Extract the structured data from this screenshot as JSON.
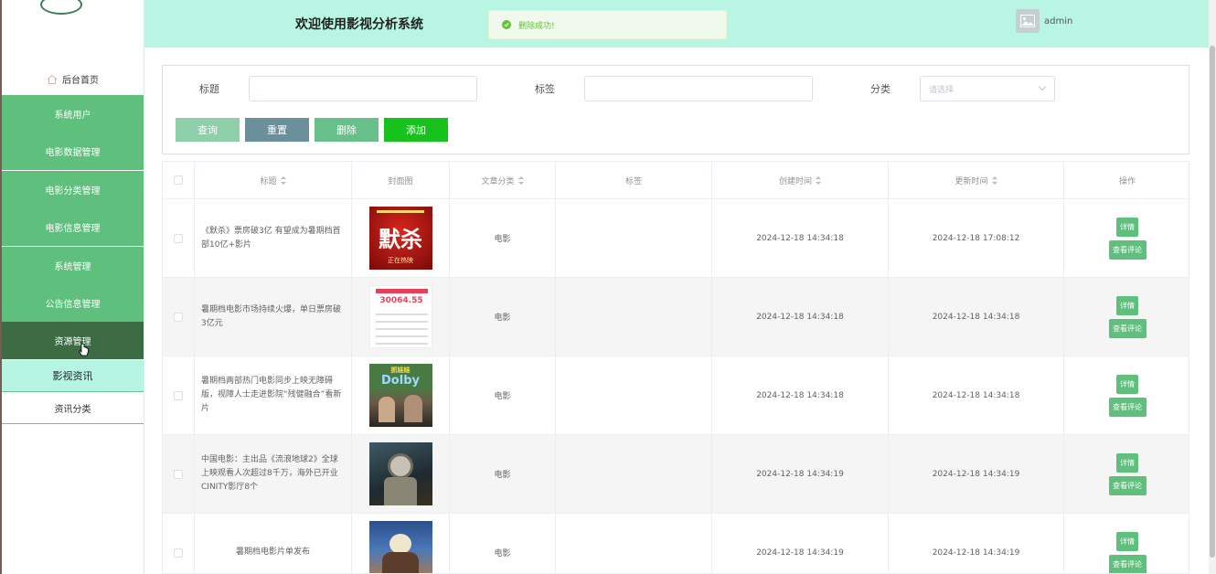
{
  "header": {
    "title": "欢迎使用影视分析系统",
    "toast": "删除成功!",
    "user": "admin"
  },
  "sidebar": {
    "home": "后台首页",
    "items": [
      "系统用户",
      "电影数据管理",
      "电影分类管理",
      "电影信息管理",
      "系统管理",
      "公告信息管理",
      "资源管理"
    ],
    "sub_items": [
      "影视资讯",
      "资讯分类"
    ]
  },
  "search": {
    "title_label": "标题",
    "tag_label": "标签",
    "category_label": "分类",
    "category_placeholder": "请选择",
    "buttons": {
      "query": "查询",
      "reset": "重置",
      "delete": "删除",
      "add": "添加"
    }
  },
  "table": {
    "headers": [
      "标题",
      "封面图",
      "文章分类",
      "标签",
      "创建时间",
      "更新时间",
      "操作"
    ],
    "rows": [
      {
        "title": "《默杀》票房破3亿 有望成为暑期档首部10亿+影片",
        "category": "电影",
        "tag": "",
        "created": "2024-12-18 14:34:18",
        "updated": "2024-12-18 17:08:12"
      },
      {
        "title": "暑期档电影市场持续火爆，单日票房破3亿元",
        "category": "电影",
        "tag": "",
        "created": "2024-12-18 14:34:18",
        "updated": "2024-12-18 14:34:18"
      },
      {
        "title": "暑期档两部热门电影同步上映无障碍版，视障人士走进影院“残健融合”看新片",
        "category": "电影",
        "tag": "",
        "created": "2024-12-18 14:34:18",
        "updated": "2024-12-18 14:34:18"
      },
      {
        "title": "中国电影：主出品《流浪地球2》全球上映观看人次超过8千万，海外已开业CINITY影厅8个",
        "category": "电影",
        "tag": "",
        "created": "2024-12-18 14:34:19",
        "updated": "2024-12-18 14:34:19"
      },
      {
        "title": "暑期档电影片单发布",
        "category": "电影",
        "tag": "",
        "created": "2024-12-18 14:34:19",
        "updated": "2024-12-18 14:34:19"
      }
    ],
    "op_detail": "详情",
    "op_comment": "查看评论"
  },
  "covers": {
    "c1_text": "默杀",
    "c1_sub": "正在热映",
    "c2_text": "30064.55",
    "c3_top": "抓娃娃",
    "c3_text": "Dolby"
  },
  "colors": {
    "accent": "#5fbf7d",
    "active": "#3d6b44",
    "header_bg": "#b8f5e2",
    "add_button": "#18c21c"
  }
}
